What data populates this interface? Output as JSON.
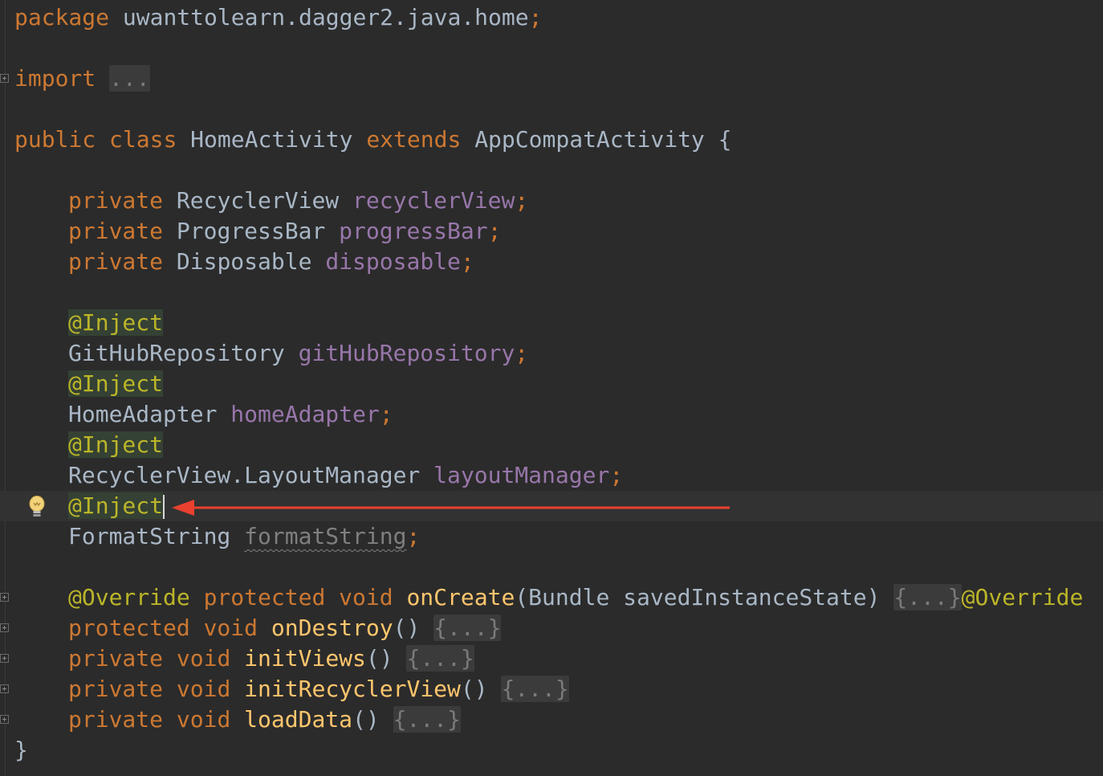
{
  "code": {
    "package_kw": "package",
    "package_name": "uwanttolearn.dagger2.java.home",
    "semicolon": ";",
    "import_kw": "import",
    "import_fold": "...",
    "public_kw": "public",
    "class_kw": "class",
    "class_name": "HomeActivity",
    "extends_kw": "extends",
    "super_class": "AppCompatActivity",
    "open_brace": "{",
    "close_brace": "}",
    "private_kw": "private",
    "protected_kw": "protected",
    "void_kw": "void",
    "fields": [
      {
        "type": "RecyclerView",
        "name": "recyclerView"
      },
      {
        "type": "ProgressBar",
        "name": "progressBar"
      },
      {
        "type": "Disposable",
        "name": "disposable"
      }
    ],
    "inject_annotation": "@Inject",
    "injected": [
      {
        "type": "GitHubRepository",
        "name": "gitHubRepository"
      },
      {
        "type": "HomeAdapter",
        "name": "homeAdapter"
      },
      {
        "type": "RecyclerView.LayoutManager",
        "name": "layoutManager"
      },
      {
        "type": "FormatString",
        "name": "formatString"
      }
    ],
    "override_annotation": "@Override",
    "on_create": {
      "name": "onCreate",
      "params": "(Bundle savedInstanceState)"
    },
    "method_fold": "{...}",
    "empty_params": "()",
    "methods": [
      {
        "modifier": "protected",
        "name": "onDestroy"
      },
      {
        "modifier": "private",
        "name": "initViews"
      },
      {
        "modifier": "private",
        "name": "initRecyclerView"
      },
      {
        "modifier": "private",
        "name": "loadData"
      }
    ]
  },
  "colors": {
    "background": "#2b2b2b",
    "keyword": "#cc7832",
    "field": "#9876aa",
    "method": "#ffc66d",
    "annotation": "#bbb529",
    "arrow": "#e8412f"
  },
  "icons": {
    "intention": "lightbulb-icon",
    "fold": "fold-plus-icon",
    "pointer": "red-arrow"
  }
}
